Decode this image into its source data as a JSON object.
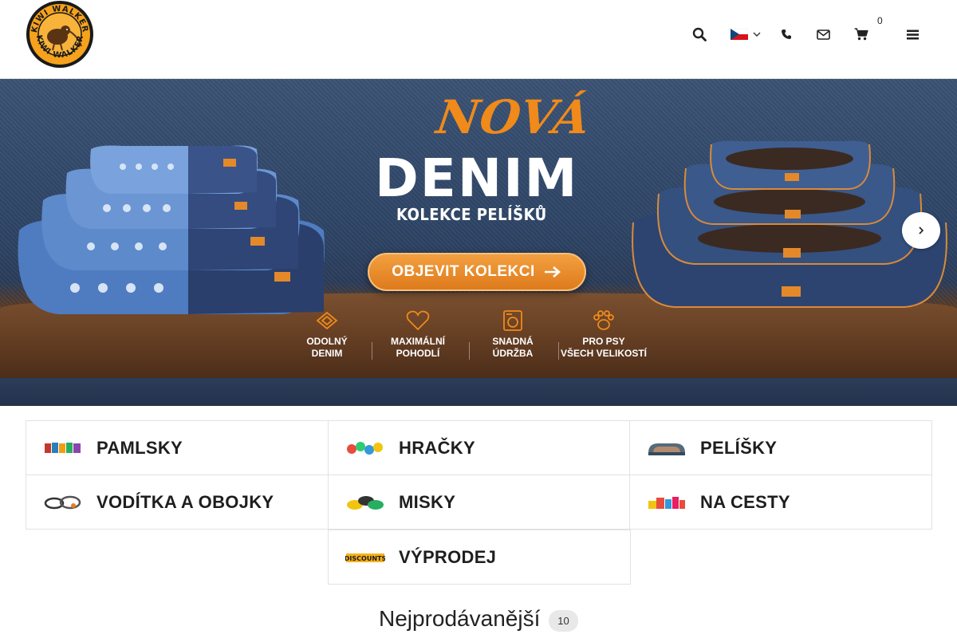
{
  "header": {
    "logo_text": "KIWI WALKER",
    "cart_count": "0",
    "language_flag": "cz-flag-icon"
  },
  "hero": {
    "headline_small": "NOVÁ",
    "headline_big": "DENIM",
    "subtitle": "KOLEKCE PELÍŠKŮ",
    "cta": "OBJEVIT KOLEKCI",
    "features": [
      {
        "line1": "ODOLNÝ",
        "line2": "DENIM"
      },
      {
        "line1": "MAXIMÁLNÍ",
        "line2": "POHODLÍ"
      },
      {
        "line1": "SNADNÁ",
        "line2": "ÚDRŽBA"
      },
      {
        "line1": "PRO PSY",
        "line2": "VŠECH VELIKOSTÍ"
      }
    ]
  },
  "categories": [
    {
      "label": "PAMLSKY"
    },
    {
      "label": "HRAČKY"
    },
    {
      "label": "PELÍŠKY"
    },
    {
      "label": "VODÍTKA A OBOJKY"
    },
    {
      "label": "MISKY"
    },
    {
      "label": "NA CESTY"
    },
    {
      "label": "VÝPRODEJ"
    }
  ],
  "bestsellers": {
    "title": "Nejprodávanější",
    "count": "10"
  },
  "colors": {
    "accent": "#f08a1a",
    "denim": "#2e4466"
  }
}
